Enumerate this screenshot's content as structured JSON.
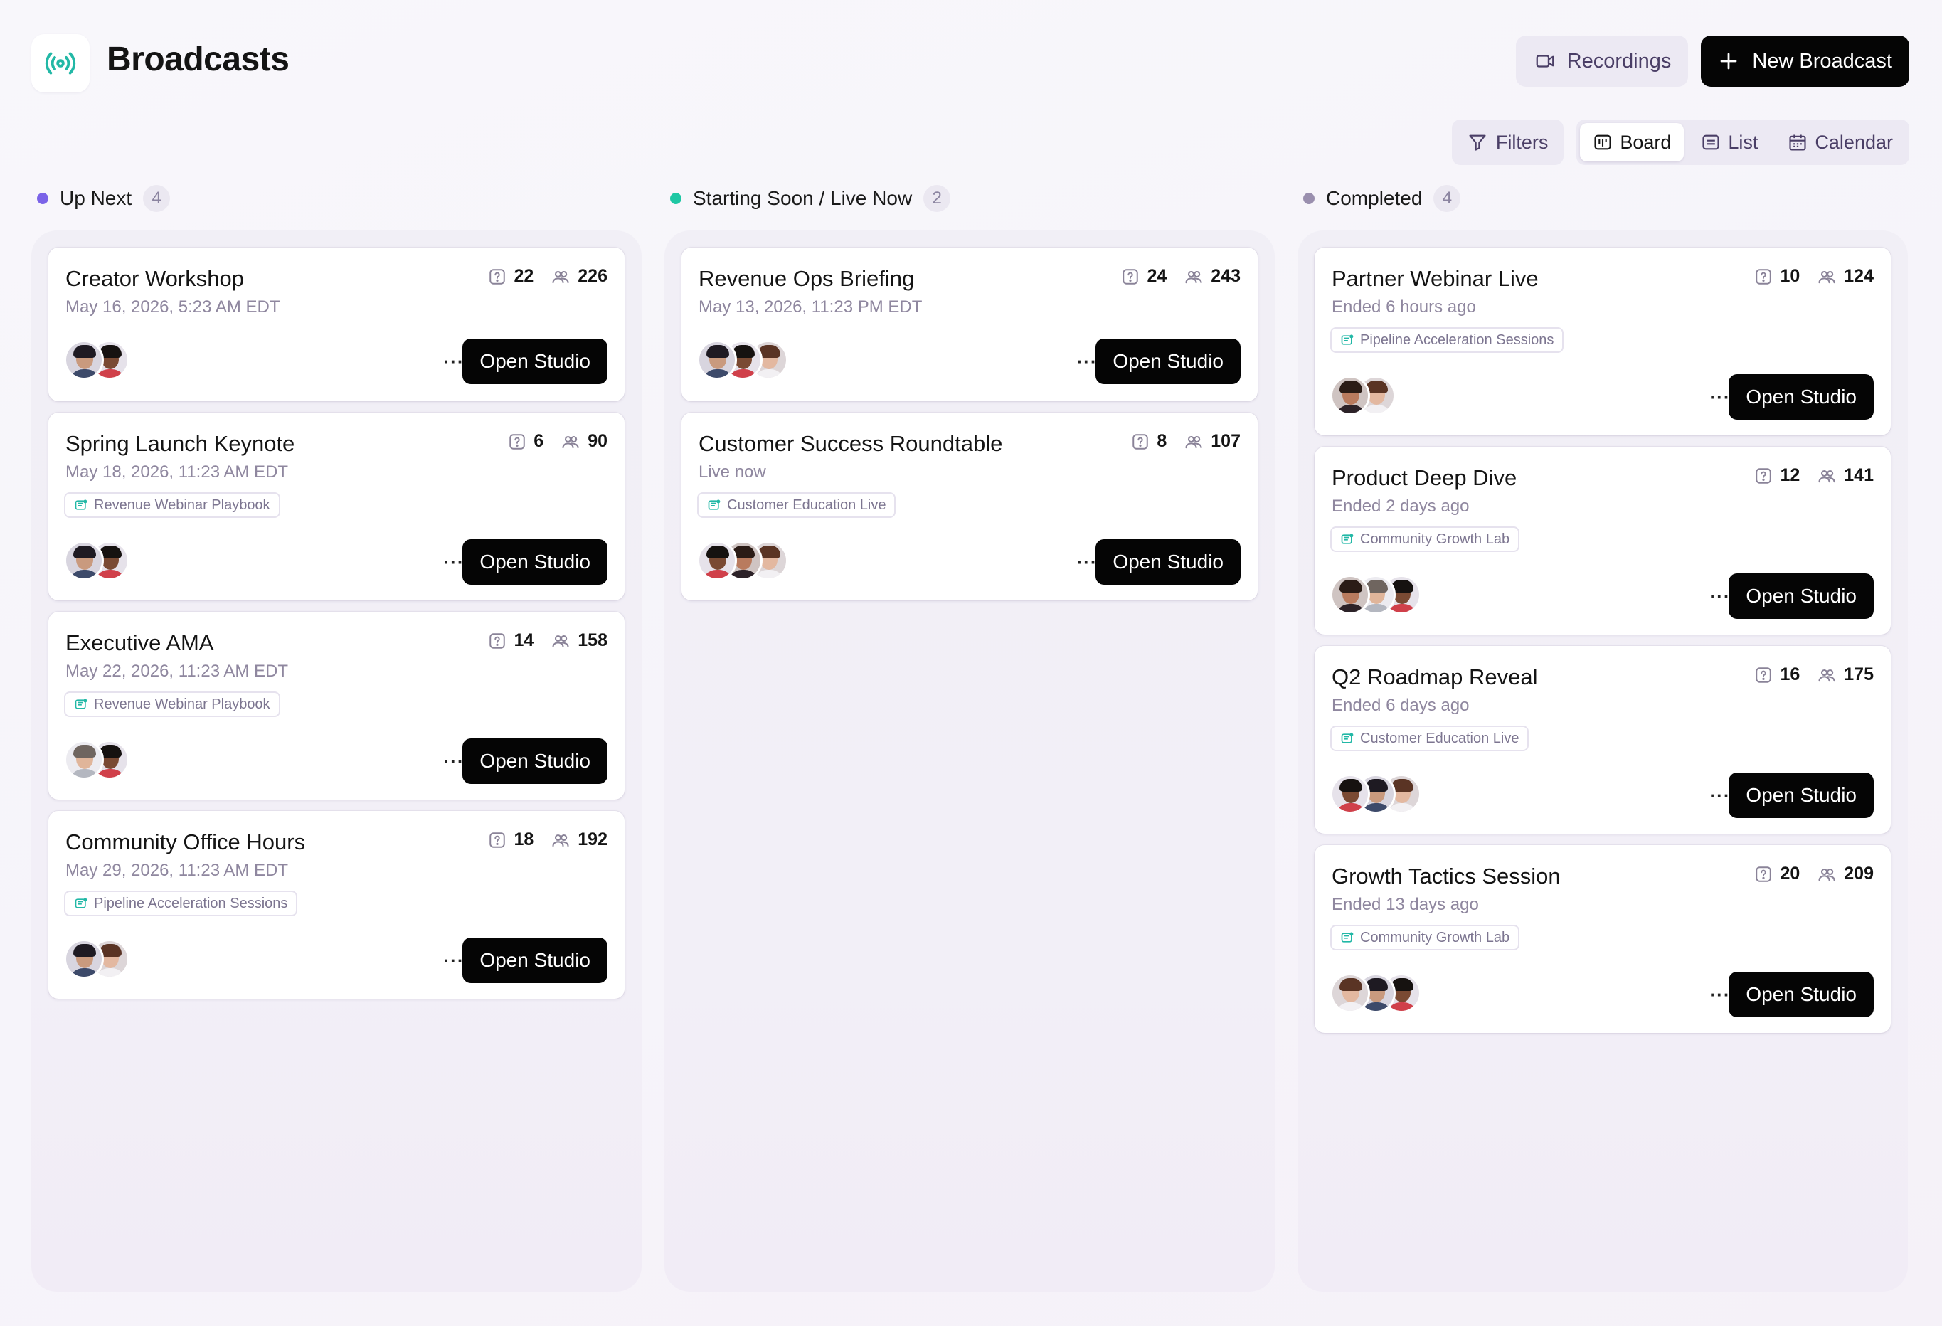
{
  "app": {
    "title": "Broadcasts",
    "logo_icon": "broadcast-icon",
    "accent": "#22b8a6"
  },
  "header": {
    "recordings_label": "Recordings",
    "recordings_icon": "video-icon",
    "new_broadcast_label": "New Broadcast",
    "new_broadcast_icon": "plus-icon"
  },
  "toolbar": {
    "filters_label": "Filters",
    "filters_icon": "filter-icon",
    "views": [
      {
        "label": "Board",
        "icon": "board-icon",
        "active": true
      },
      {
        "label": "List",
        "icon": "list-icon",
        "active": false
      },
      {
        "label": "Calendar",
        "icon": "calendar-icon",
        "active": false
      }
    ]
  },
  "columns": [
    {
      "title": "Up Next",
      "count": "4",
      "dot_color": "#7b63e8",
      "cards": [
        {
          "title": "Creator Workshop",
          "subtitle": "May 16, 2026, 5:23 AM EDT",
          "questions": "22",
          "attendees": "226",
          "tag": "",
          "avatars": [
            "a",
            "b"
          ]
        },
        {
          "title": "Spring Launch Keynote",
          "subtitle": "May 18, 2026, 11:23 AM EDT",
          "questions": "6",
          "attendees": "90",
          "tag": "Revenue Webinar Playbook",
          "avatars": [
            "a",
            "b"
          ]
        },
        {
          "title": "Executive AMA",
          "subtitle": "May 22, 2026, 11:23 AM EDT",
          "questions": "14",
          "attendees": "158",
          "tag": "Revenue Webinar Playbook",
          "avatars": [
            "c",
            "b"
          ]
        },
        {
          "title": "Community Office Hours",
          "subtitle": "May 29, 2026, 11:23 AM EDT",
          "questions": "18",
          "attendees": "192",
          "tag": "Pipeline Acceleration Sessions",
          "avatars": [
            "a",
            "d"
          ]
        }
      ]
    },
    {
      "title": "Starting Soon / Live Now",
      "count": "2",
      "dot_color": "#1fc7a4",
      "cards": [
        {
          "title": "Revenue Ops Briefing",
          "subtitle": "May 13, 2026, 11:23 PM EDT",
          "questions": "24",
          "attendees": "243",
          "tag": "",
          "avatars": [
            "a",
            "b",
            "d"
          ]
        },
        {
          "title": "Customer Success Roundtable",
          "subtitle": "Live now",
          "questions": "8",
          "attendees": "107",
          "tag": "Customer Education Live",
          "avatars": [
            "b",
            "e",
            "d"
          ]
        }
      ]
    },
    {
      "title": "Completed",
      "count": "4",
      "dot_color": "#9a8fae",
      "cards": [
        {
          "title": "Partner Webinar Live",
          "subtitle": "Ended 6 hours ago",
          "questions": "10",
          "attendees": "124",
          "tag": "Pipeline Acceleration Sessions",
          "avatars": [
            "e",
            "d"
          ]
        },
        {
          "title": "Product Deep Dive",
          "subtitle": "Ended 2 days ago",
          "questions": "12",
          "attendees": "141",
          "tag": "Community Growth Lab",
          "avatars": [
            "e",
            "c",
            "b"
          ]
        },
        {
          "title": "Q2 Roadmap Reveal",
          "subtitle": "Ended 6 days ago",
          "questions": "16",
          "attendees": "175",
          "tag": "Customer Education Live",
          "avatars": [
            "b",
            "a",
            "d"
          ]
        },
        {
          "title": "Growth Tactics Session",
          "subtitle": "Ended 13 days ago",
          "questions": "20",
          "attendees": "209",
          "tag": "Community Growth Lab",
          "avatars": [
            "d",
            "a",
            "b"
          ]
        }
      ]
    }
  ],
  "card_actions": {
    "more_label": "···",
    "open_label": "Open Studio"
  }
}
